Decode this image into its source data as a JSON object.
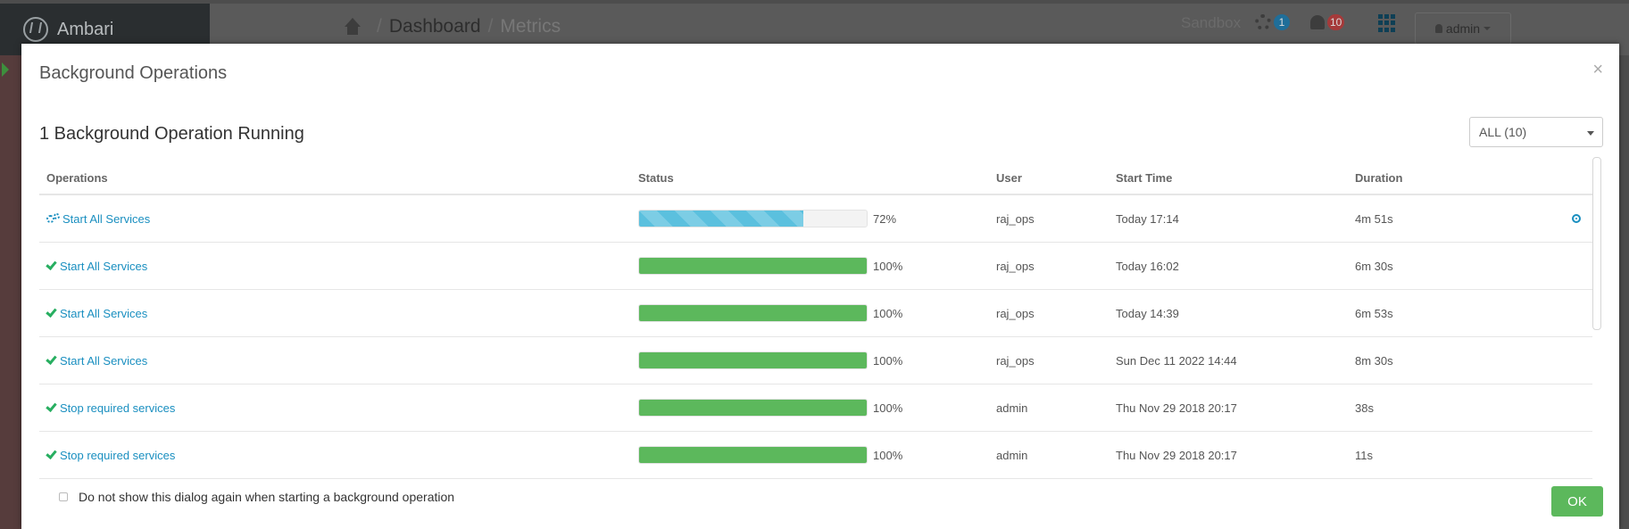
{
  "app": {
    "brand": "Ambari",
    "breadcrumb": {
      "current": "Dashboard",
      "next": "Metrics"
    },
    "cluster": "Sandbox",
    "ops_count": "1",
    "alerts_count": "10",
    "user": "admin"
  },
  "modal": {
    "title": "Background Operations",
    "close": "×",
    "running_title": "1 Background Operation Running",
    "filter": "ALL (10)",
    "columns": {
      "operations": "Operations",
      "status": "Status",
      "user": "User",
      "start_time": "Start Time",
      "duration": "Duration"
    },
    "rows": [
      {
        "name": "Start All Services",
        "progress": 72,
        "progress_label": "72%",
        "state": "running",
        "user": "raj_ops",
        "start": "Today 17:14",
        "duration": "4m 51s"
      },
      {
        "name": "Start All Services",
        "progress": 100,
        "progress_label": "100%",
        "state": "done",
        "user": "raj_ops",
        "start": "Today 16:02",
        "duration": "6m 30s"
      },
      {
        "name": "Start All Services",
        "progress": 100,
        "progress_label": "100%",
        "state": "done",
        "user": "raj_ops",
        "start": "Today 14:39",
        "duration": "6m 53s"
      },
      {
        "name": "Start All Services",
        "progress": 100,
        "progress_label": "100%",
        "state": "done",
        "user": "raj_ops",
        "start": "Sun Dec 11 2022 14:44",
        "duration": "8m 30s"
      },
      {
        "name": "Stop required services",
        "progress": 100,
        "progress_label": "100%",
        "state": "done",
        "user": "admin",
        "start": "Thu Nov 29 2018 20:17",
        "duration": "38s"
      },
      {
        "name": "Stop required services",
        "progress": 100,
        "progress_label": "100%",
        "state": "done",
        "user": "admin",
        "start": "Thu Nov 29 2018 20:17",
        "duration": "11s"
      }
    ],
    "dont_show_label": "Do not show this dialog again when starting a background operation",
    "ok": "OK"
  },
  "colors": {
    "link": "#1a8fc0",
    "success": "#5cb85c",
    "running": "#5bc0de",
    "badge_ops": "#1f6e99",
    "badge_alerts": "#a53a3a"
  }
}
